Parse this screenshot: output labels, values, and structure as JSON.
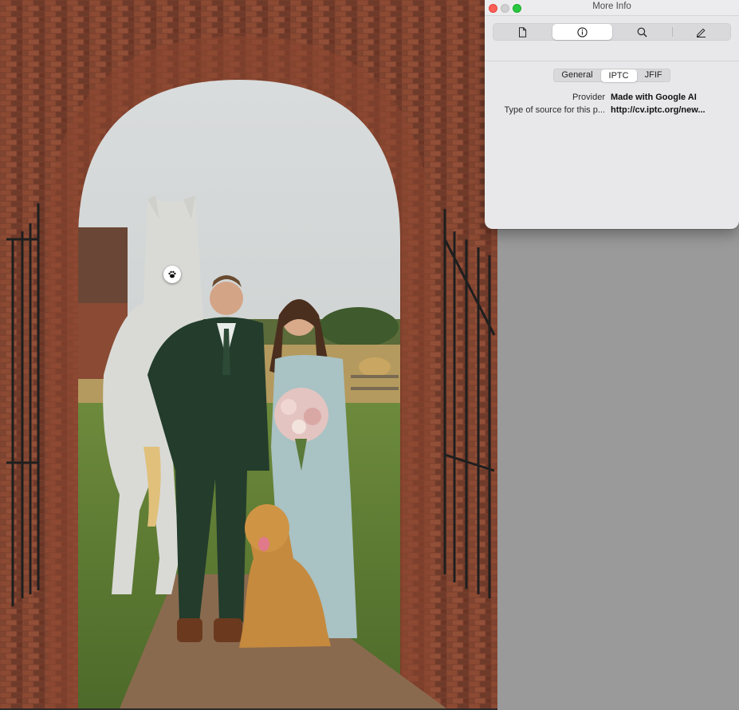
{
  "window": {
    "title": "More Info"
  },
  "toolbar": {
    "tabs": [
      {
        "icon": "document-icon",
        "active": false
      },
      {
        "icon": "info-icon",
        "active": true
      },
      {
        "icon": "magnifier-icon",
        "active": false
      },
      {
        "icon": "pencil-icon",
        "active": false
      }
    ]
  },
  "metadata_tabs": {
    "items": [
      "General",
      "IPTC",
      "JFIF"
    ],
    "selected": "IPTC"
  },
  "iptc": {
    "rows": [
      {
        "key": "Provider",
        "value": "Made with Google AI"
      },
      {
        "key": "Type of source for this p...",
        "value": "http://cv.iptc.org/new..."
      }
    ]
  },
  "colors": {
    "accent_close": "#fe5f57",
    "accent_max": "#28c840",
    "panel_bg": "#e8e8ea",
    "backdrop": "#9a9a9a"
  }
}
